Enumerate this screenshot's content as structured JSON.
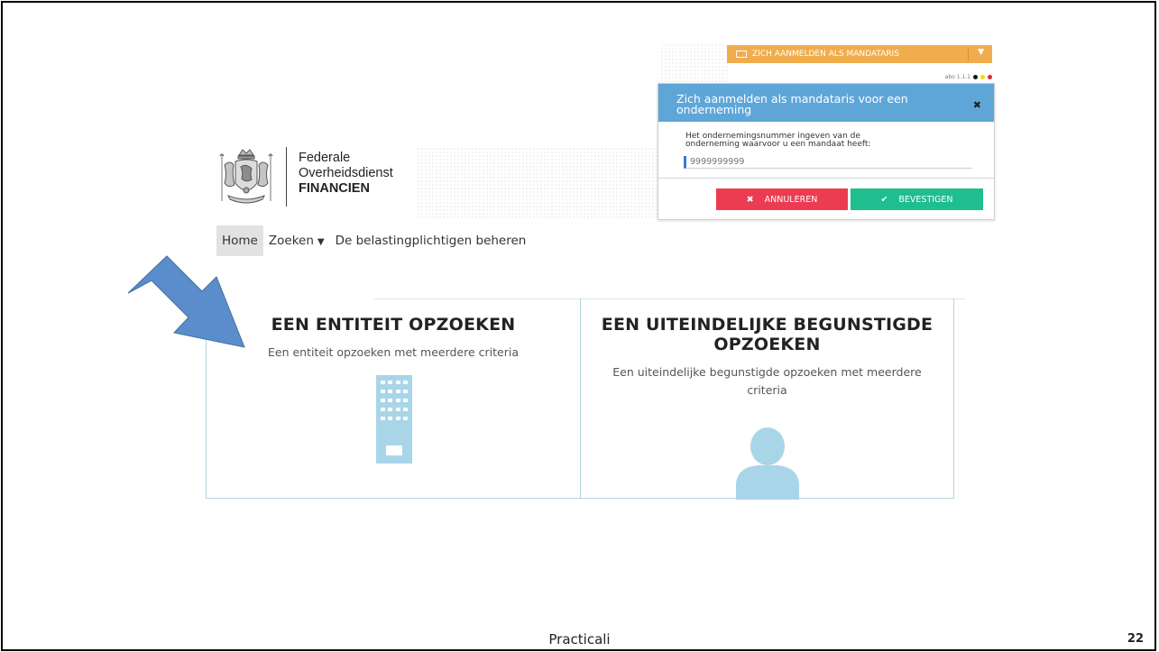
{
  "logo": {
    "line1": "Federale",
    "line2": "Overheidsdienst",
    "line3": "FINANCIEN"
  },
  "nav": {
    "items": [
      {
        "label": "Home",
        "active": true
      },
      {
        "label": "Zoeken",
        "has_dropdown": true
      },
      {
        "label": "De belastingplichtigen beheren"
      }
    ]
  },
  "cards": [
    {
      "title": "EEN ENTITEIT OPZOEKEN",
      "subtitle": "Een entiteit opzoeken met meerdere criteria",
      "icon": "building-icon"
    },
    {
      "title_line1": "EEN UITEINDELIJKE BEGUNSTIGDE",
      "title_line2": "OPZOEKEN",
      "subtitle_line1": "Een uiteindelijke begunstigde opzoeken met meerdere",
      "subtitle_line2": "criteria",
      "icon": "person-icon"
    }
  ],
  "mandate_bar": {
    "button_label": "ZICH AANMELDEN ALS MANDATARIS",
    "version": "abo 1.1.1"
  },
  "modal": {
    "title_line1": "Zich aanmelden als mandataris voor een",
    "title_line2": "onderneming",
    "label_line1": "Het ondernemingsnummer ingeven van de",
    "label_line2": "onderneming waarvoor u een mandaat heeft:",
    "input_placeholder": "9999999999",
    "cancel_label": "ANNULEREN",
    "confirm_label": "BEVESTIGEN"
  },
  "slide": {
    "footer_title": "Practicali",
    "page_number": "22"
  },
  "colors": {
    "accent_orange": "#f0ad4e",
    "modal_header_blue": "#5fa6d8",
    "cancel_red": "#ec3c52",
    "confirm_green": "#1fbe8f",
    "icon_light_blue": "#a9d5e8",
    "arrow_blue": "#5b8ccb"
  }
}
